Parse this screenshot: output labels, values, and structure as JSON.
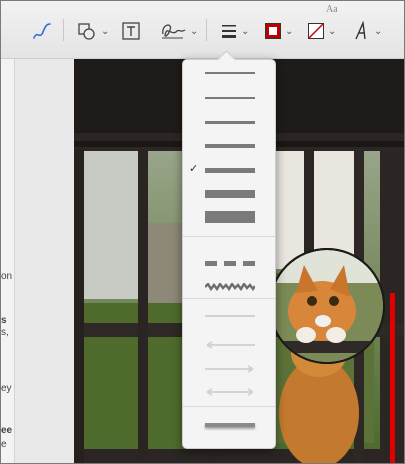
{
  "toolbar": {
    "background_text": "Aa",
    "tools": [
      {
        "name": "sketch"
      },
      {
        "name": "shapes"
      },
      {
        "name": "text"
      },
      {
        "name": "sign"
      },
      {
        "name": "shape-style"
      },
      {
        "name": "border-color"
      },
      {
        "name": "fill-color"
      },
      {
        "name": "text-style"
      }
    ]
  },
  "left_strip": {
    "fragments": [
      "on",
      "s",
      "s,",
      "ey",
      "ee",
      "e"
    ]
  },
  "menu": {
    "line_weights": [
      1,
      2,
      3,
      4,
      6,
      8
    ],
    "selected_weight_index": 3,
    "check_mark": "✓",
    "dash_styles": [
      "dashed",
      "jagged"
    ],
    "arrow_styles": [
      "plain",
      "left-arrow",
      "right-arrow",
      "double-arrow"
    ],
    "shadow_style": "shadow"
  },
  "colors": {
    "accent": "#2f6fd6",
    "border": "#c00000",
    "marker": "#e00000"
  }
}
